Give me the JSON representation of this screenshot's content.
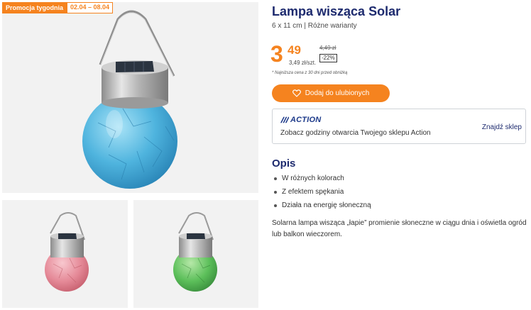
{
  "promo": {
    "label": "Promocja tygodnia",
    "dates": "02.04 – 08.04"
  },
  "product": {
    "title": "Lampa wisząca Solar",
    "subtitle": "6 x 11 cm | Różne warianty"
  },
  "price": {
    "integer": "3",
    "decimal": "49",
    "unit_price": "3,49 zł/szt.",
    "old_price": "4,49 zł",
    "discount": "-22%",
    "footnote": "* Najniższa cena z 30 dni przed obniżką"
  },
  "favorite_button": {
    "label": "Dodaj do ulubionych",
    "icon": "heart-icon"
  },
  "store": {
    "brand": "ACTION",
    "hours_text": "Zobacz godziny otwarcia Twojego sklepu Action",
    "find_link": "Znajdź sklep"
  },
  "description": {
    "heading": "Opis",
    "bullets": [
      "W różnych kolorach",
      "Z efektem spękania",
      "Działa na energię słoneczną"
    ],
    "text": "Solarna lampa wisząca „łapie” promienie słoneczne w ciągu dnia i oświetla ogród lub balkon wieczorem."
  },
  "gallery": [
    {
      "variant": "blue",
      "color": "#4fb4de"
    },
    {
      "variant": "pink",
      "color": "#e58a98"
    },
    {
      "variant": "green",
      "color": "#5cbf5a"
    }
  ],
  "colors": {
    "accent": "#f5831f",
    "brand_blue": "#1d2a6e"
  }
}
